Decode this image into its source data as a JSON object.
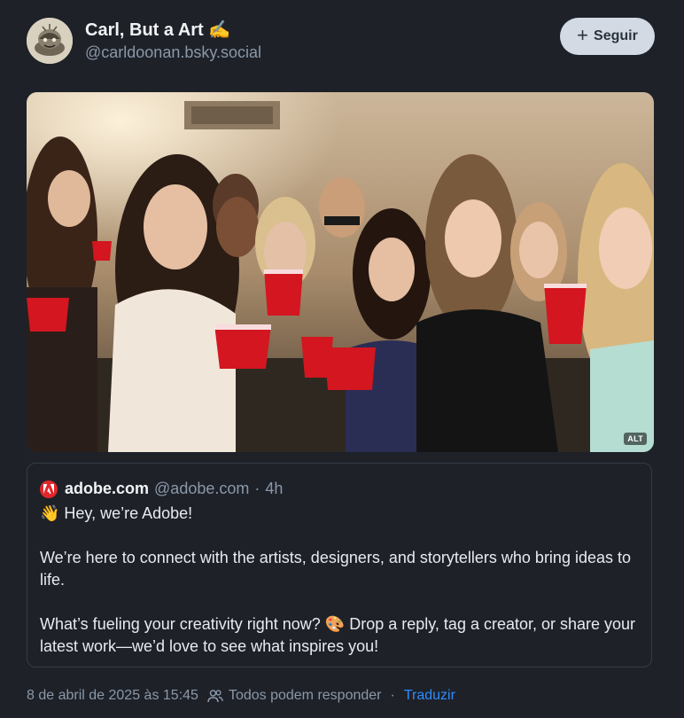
{
  "author": {
    "display_name": "Carl, But a Art ✍️",
    "handle": "@carldoonan.bsky.social",
    "avatar_icon": "avatar-illustration"
  },
  "follow_button": {
    "icon": "plus-icon",
    "label": "Seguir"
  },
  "media": {
    "alt_badge": "ALT"
  },
  "quoted_post": {
    "author_icon": "adobe-logo",
    "author_name": "adobe.com",
    "author_handle": "@adobe.com",
    "separator": "·",
    "time": "4h",
    "lines": [
      "👋 Hey, we’re Adobe!",
      "We’re here to connect with the artists, designers, and storytellers who bring ideas to life.",
      "What’s fueling your creativity right now? 🎨 Drop a reply, tag a creator, or share your latest work—we’d love to see what inspires you!"
    ]
  },
  "footer": {
    "timestamp": "8 de abril de 2025 às 15:45",
    "reply_icon": "people-icon",
    "reply_setting": "Todos podem responder",
    "separator": "·",
    "translate": "Traduzir"
  },
  "colors": {
    "background": "#1e2128",
    "accent": "#2d8cff",
    "adobe_red": "#e0262b"
  }
}
